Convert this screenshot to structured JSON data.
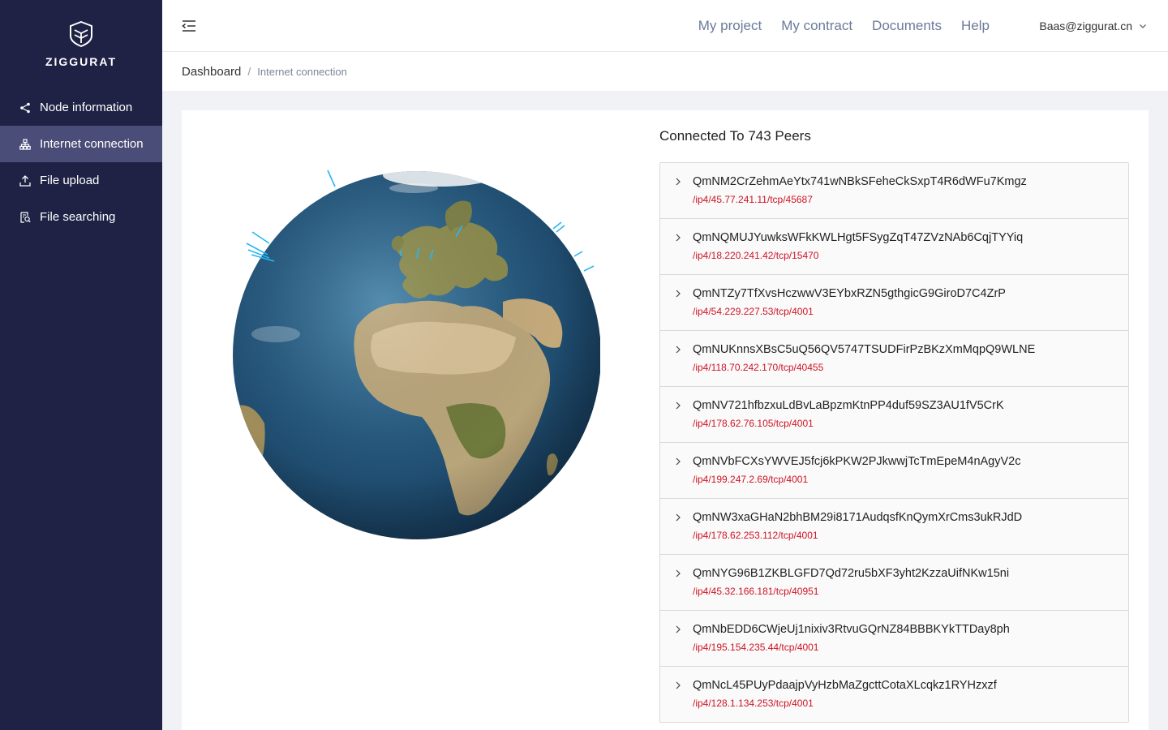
{
  "brand": {
    "name": "ZIGGURAT"
  },
  "sidebar": {
    "items": [
      {
        "label": "Node information",
        "icon": "share-icon",
        "active": false
      },
      {
        "label": "Internet connection",
        "icon": "network-icon",
        "active": true
      },
      {
        "label": "File upload",
        "icon": "upload-icon",
        "active": false
      },
      {
        "label": "File searching",
        "icon": "file-search-icon",
        "active": false
      }
    ]
  },
  "header": {
    "nav": [
      "My project",
      "My contract",
      "Documents",
      "Help"
    ],
    "user": "Baas@ziggurat.cn"
  },
  "breadcrumb": {
    "root": "Dashboard",
    "separator": "/",
    "current": "Internet connection"
  },
  "peers": {
    "title": "Connected To 743 Peers",
    "items": [
      {
        "id": "QmNM2CrZehmAeYtx741wNBkSFeheCkSxpT4R6dWFu7Kmgz",
        "addr": "/ip4/45.77.241.11/tcp/45687"
      },
      {
        "id": "QmNQMUJYuwksWFkKWLHgt5FSygZqT47ZVzNAb6CqjTYYiq",
        "addr": "/ip4/18.220.241.42/tcp/15470"
      },
      {
        "id": "QmNTZy7TfXvsHczwwV3EYbxRZN5gthgicG9GiroD7C4ZrP",
        "addr": "/ip4/54.229.227.53/tcp/4001"
      },
      {
        "id": "QmNUKnnsXBsC5uQ56QV5747TSUDFirPzBKzXmMqpQ9WLNE",
        "addr": "/ip4/118.70.242.170/tcp/40455"
      },
      {
        "id": "QmNV721hfbzxuLdBvLaBpzmKtnPP4duf59SZ3AU1fV5CrK",
        "addr": "/ip4/178.62.76.105/tcp/4001"
      },
      {
        "id": "QmNVbFCXsYWVEJ5fcj6kPKW2PJkwwjTcTmEpeM4nAgyV2c",
        "addr": "/ip4/199.247.2.69/tcp/4001"
      },
      {
        "id": "QmNW3xaGHaN2bhBM29i8171AudqsfKnQymXrCms3ukRJdD",
        "addr": "/ip4/178.62.253.112/tcp/4001"
      },
      {
        "id": "QmNYG96B1ZKBLGFD7Qd72ru5bXF3yht2KzzaUifNKw15ni",
        "addr": "/ip4/45.32.166.181/tcp/40951"
      },
      {
        "id": "QmNbEDD6CWjeUj1nixiv3RtvuGQrNZ84BBBKYkTTDay8ph",
        "addr": "/ip4/195.154.235.44/tcp/4001"
      },
      {
        "id": "QmNcL45PUyPdaajpVyHzbMaZgcttCotaXLcqkz1RYHzxzf",
        "addr": "/ip4/128.1.134.253/tcp/4001"
      }
    ]
  },
  "colors": {
    "sidebar_bg": "#1f2245",
    "sidebar_active": "#4a4d77",
    "address": "#cf1322",
    "topnav": "#6b7b99",
    "peer_line": "#29b6f6"
  }
}
